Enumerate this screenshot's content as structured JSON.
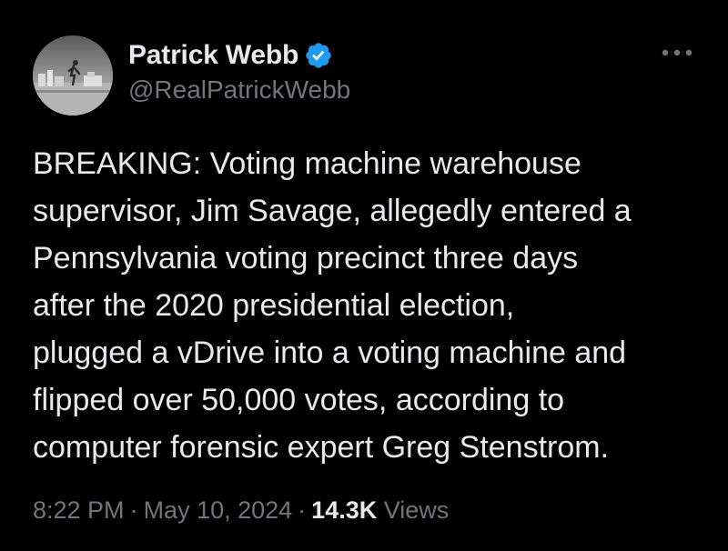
{
  "author": {
    "display_name": "Patrick Webb",
    "handle": "@RealPatrickWebb",
    "verified_icon": "verified-badge-icon",
    "badge_color": "#1d9bf0"
  },
  "actions": {
    "more_icon": "more-options-icon"
  },
  "post": {
    "text": "BREAKING: Voting machine warehouse\nsupervisor, Jim Savage, allegedly entered a\nPennsylvania voting precinct three days\nafter the 2020 presidential election,\nplugged a vDrive into a voting machine and\nflipped over 50,000 votes, according to\ncomputer forensic expert Greg Stenstrom."
  },
  "meta": {
    "time": "8:22 PM",
    "separator": "·",
    "date": "May 10, 2024",
    "views_count": "14.3K",
    "views_label": "Views"
  },
  "colors": {
    "background": "#000000",
    "primary_text": "#e7e9ea",
    "secondary_text": "#71767b"
  }
}
